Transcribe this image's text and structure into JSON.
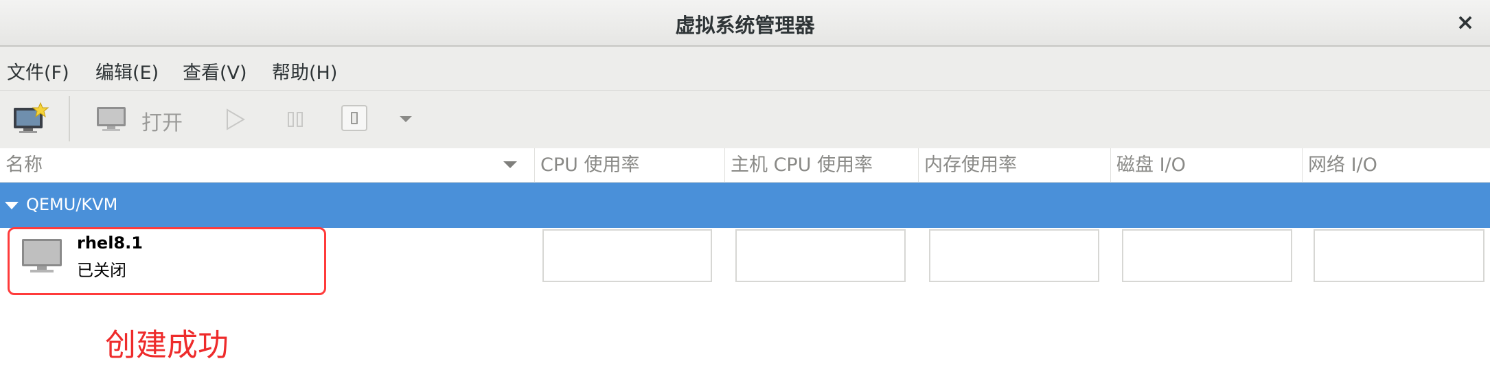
{
  "window": {
    "title": "虚拟系统管理器",
    "close_label": "×"
  },
  "menu": {
    "items": [
      "文件(F)",
      "编辑(E)",
      "查看(V)",
      "帮助(H)"
    ]
  },
  "toolbar": {
    "open_label": "打开"
  },
  "table": {
    "columns": [
      "名称",
      "CPU 使用率",
      "主机 CPU 使用率",
      "内存使用率",
      "磁盘 I/O",
      "网络 I/O"
    ],
    "group": {
      "label": "QEMU/KVM"
    },
    "vms": [
      {
        "name": "rhel8.1",
        "status": "已关闭"
      }
    ]
  },
  "annotation": {
    "text": "创建成功",
    "color": "#ee2b2b"
  },
  "colors": {
    "selection": "#4a90d9",
    "highlight_border": "#ff3b3b"
  },
  "icons": [
    "new-vm-icon",
    "monitor-icon",
    "play-icon",
    "pause-icon",
    "shutdown-icon",
    "chevron-down-icon",
    "vm-monitor-icon"
  ]
}
